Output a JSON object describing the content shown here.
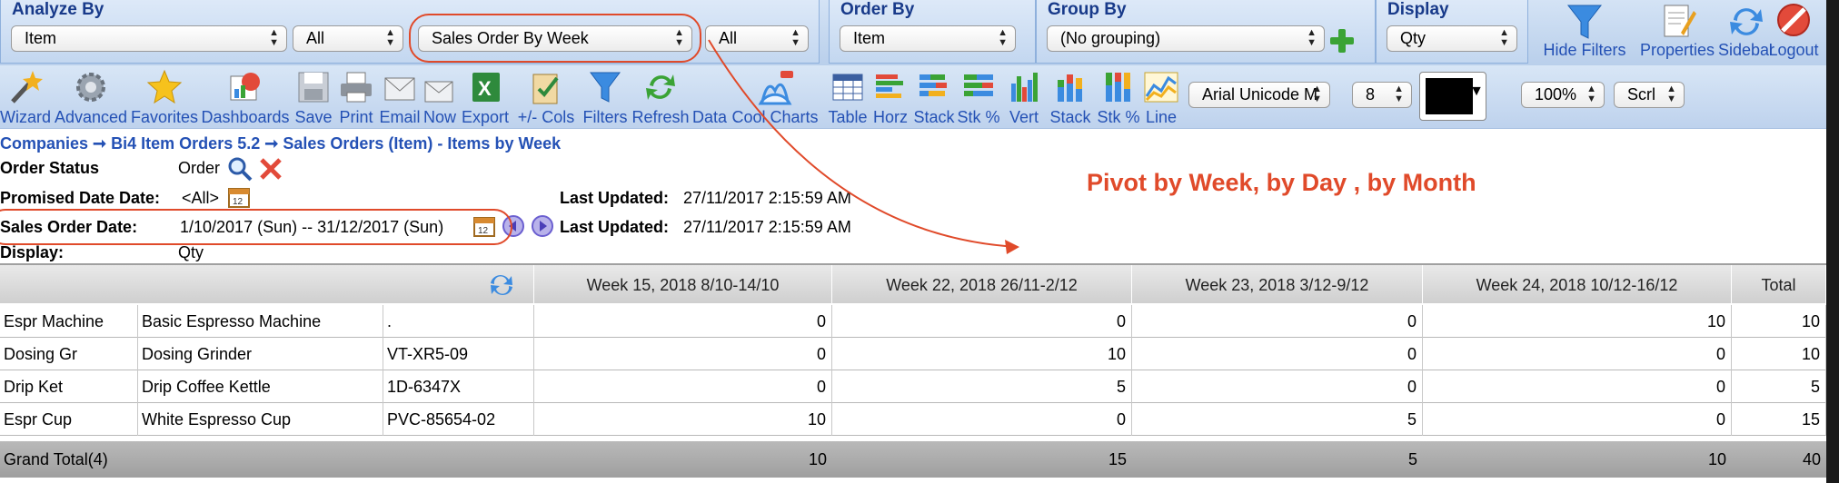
{
  "filters": {
    "analyze_by": {
      "title": "Analyze By",
      "field1": "Item",
      "field2": "All",
      "field3": "Sales Order By Week",
      "field4": "All"
    },
    "order_by": {
      "title": "Order By",
      "value": "Item"
    },
    "group_by": {
      "title": "Group By",
      "value": "(No grouping)"
    },
    "display": {
      "title": "Display",
      "value": "Qty"
    }
  },
  "header_buttons": [
    {
      "label": "Hide Filters"
    },
    {
      "label": "Properties"
    },
    {
      "label": "Sidebar"
    },
    {
      "label": "Logout"
    }
  ],
  "toolbar": {
    "items": [
      {
        "label": "Wizard"
      },
      {
        "label": "Advanced"
      },
      {
        "label": "Favorites"
      },
      {
        "label": "Dashboards"
      },
      {
        "label": "Save"
      },
      {
        "label": "Print"
      },
      {
        "label": "Email"
      },
      {
        "label": "Now"
      },
      {
        "label": "Export"
      },
      {
        "label": "+/- Cols"
      },
      {
        "label": "Filters"
      },
      {
        "label": "Refresh"
      },
      {
        "label": "Data"
      },
      {
        "label": "Cool Charts"
      },
      {
        "label": "Table"
      },
      {
        "label": "Horz"
      },
      {
        "label": "Stack"
      },
      {
        "label": "Stk %"
      },
      {
        "label": "Vert"
      },
      {
        "label": "Stack"
      },
      {
        "label": "Stk %"
      },
      {
        "label": "Line"
      }
    ],
    "font_family": "Arial Unicode M",
    "font_size": "8",
    "zoom": "100%",
    "scroll": "Scrl",
    "color": "#000000"
  },
  "breadcrumb": {
    "items": [
      "Companies",
      "Bi4 Item Orders 5.2",
      "Sales Orders (Item) - Items by Week"
    ],
    "separator": "➞"
  },
  "info": {
    "order_status_label": "Order Status",
    "order_status_value": "Order",
    "promised_label": "Promised Date Date:",
    "promised_value": "<All>",
    "last_updated_label": "Last Updated:",
    "last_updated_value1": "27/11/2017 2:15:59 AM",
    "sales_order_label": "Sales Order Date:",
    "sales_order_value": "1/10/2017 (Sun) -- 31/12/2017 (Sun)",
    "last_updated_value2": "27/11/2017 2:15:59 AM",
    "display_label": "Display:",
    "display_value": "Qty"
  },
  "annotation": "Pivot by Week, by Day , by Month",
  "table": {
    "headers": [
      "Week 15, 2018 8/10-14/10",
      "Week 22, 2018 26/11-2/12",
      "Week 23, 2018 3/12-9/12",
      "Week 24, 2018 10/12-16/12",
      "Total"
    ],
    "rows": [
      {
        "code": "Espr Machine",
        "name": "Basic Espresso Machine",
        "sku": ".",
        "w15": "0",
        "w22": "0",
        "w23": "0",
        "w24": "10",
        "total": "10"
      },
      {
        "code": "Dosing Gr",
        "name": "Dosing Grinder",
        "sku": "VT-XR5-09",
        "w15": "0",
        "w22": "10",
        "w23": "0",
        "w24": "0",
        "total": "10"
      },
      {
        "code": "Drip Ket",
        "name": "Drip Coffee Kettle",
        "sku": "1D-6347X",
        "w15": "0",
        "w22": "5",
        "w23": "0",
        "w24": "0",
        "total": "5"
      },
      {
        "code": "Espr Cup",
        "name": "White Espresso Cup",
        "sku": "PVC-85654-02",
        "w15": "10",
        "w22": "0",
        "w23": "5",
        "w24": "0",
        "total": "15"
      }
    ],
    "grand_total": {
      "label": "Grand Total(4)",
      "w15": "10",
      "w22": "15",
      "w23": "5",
      "w24": "10",
      "total": "40"
    }
  },
  "colors": {
    "accent": "#2451b5",
    "annotation": "#e04a2a",
    "title": "#183a8a"
  }
}
